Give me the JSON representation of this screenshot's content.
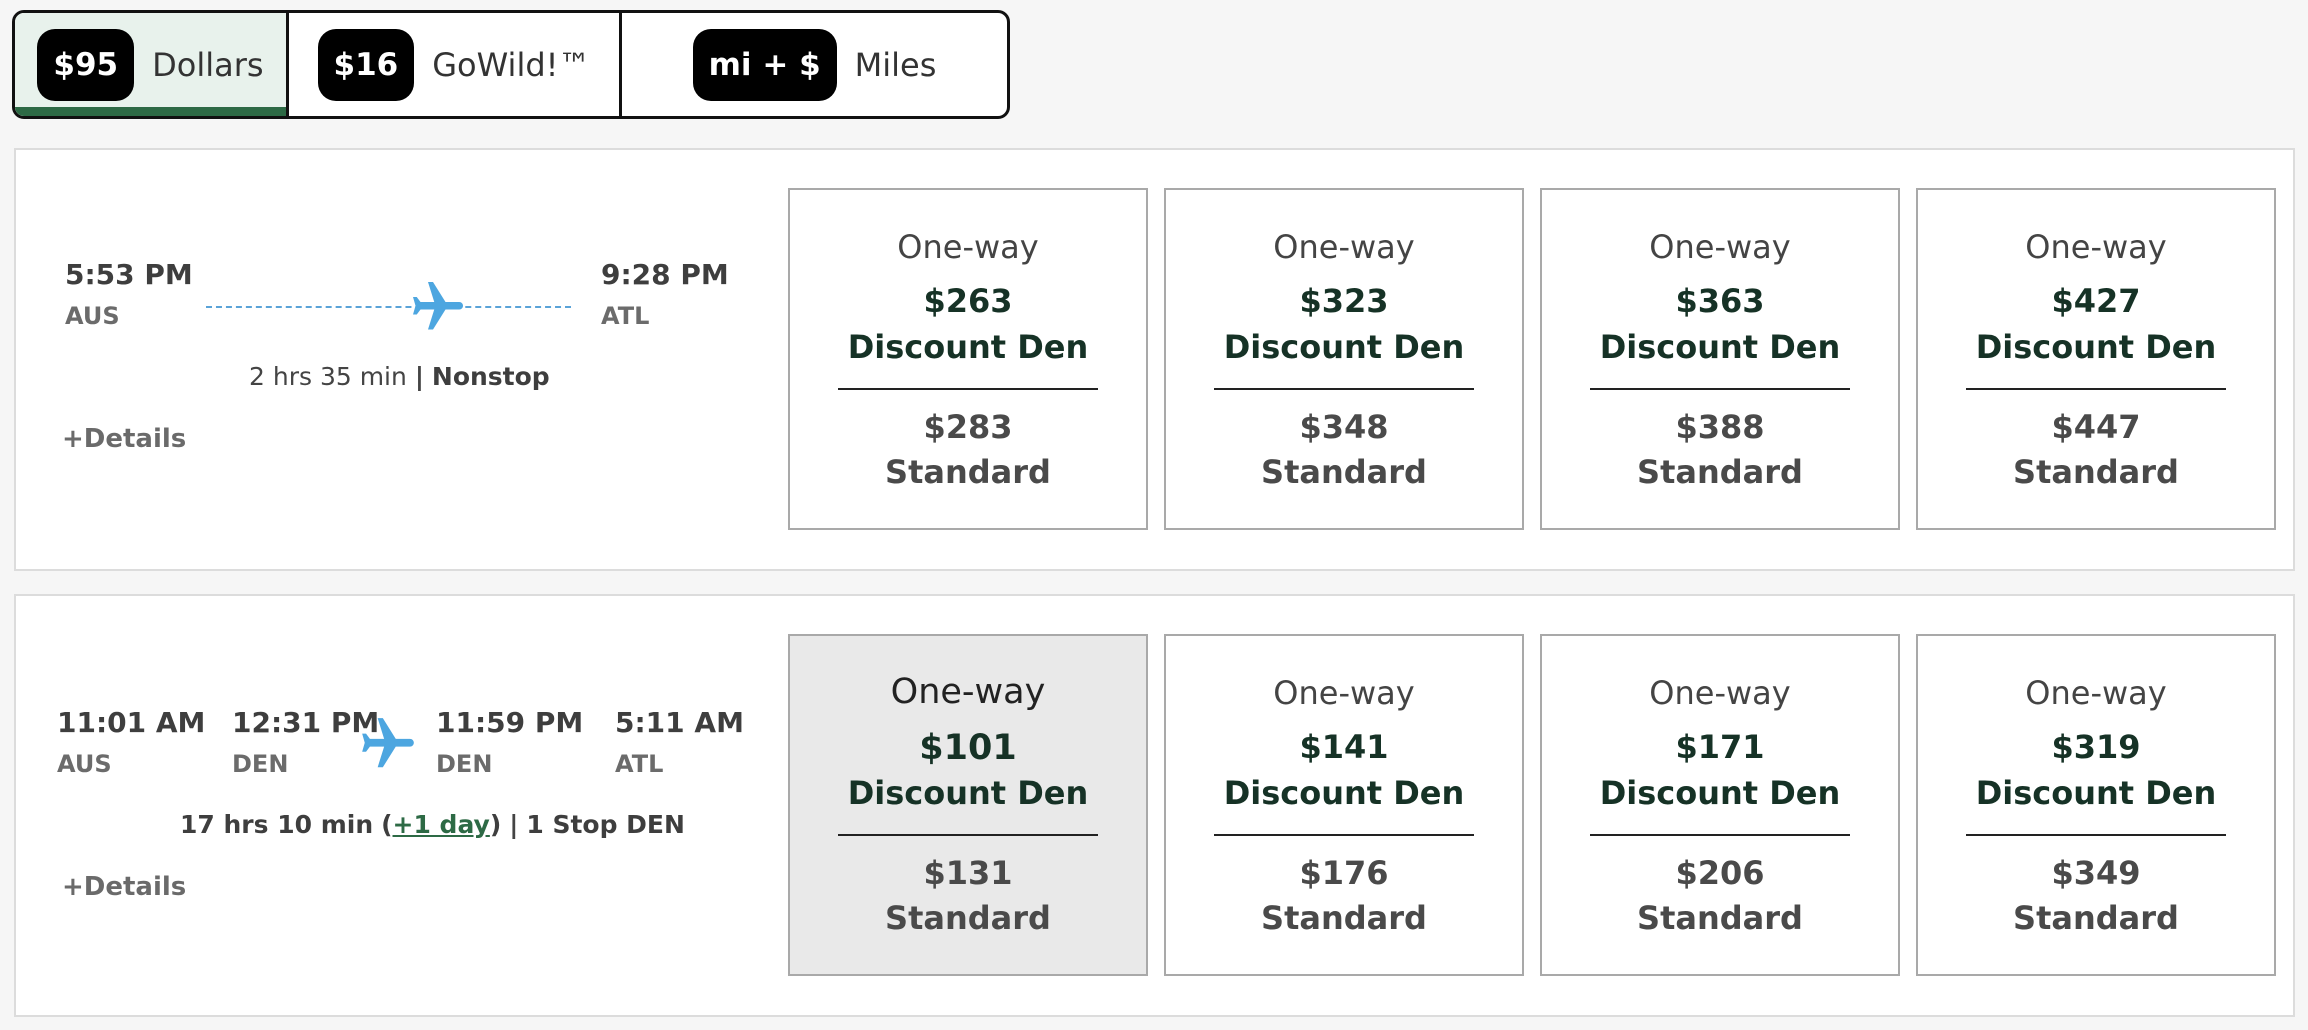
{
  "fare_tabs": [
    {
      "badge": "$95",
      "label": "Dollars",
      "selected": true
    },
    {
      "badge": "$16",
      "label": "GoWild!™",
      "selected": false
    },
    {
      "badge": "mi + $",
      "label": "Miles",
      "selected": false
    }
  ],
  "colors": {
    "accent_green": "#2d6a45",
    "fare_text": "#163226",
    "route_line": "#5aa3d8",
    "plane": "#4da6e0"
  },
  "flights": [
    {
      "depart_time": "5:53 PM",
      "depart_airport": "AUS",
      "arrive_time": "9:28 PM",
      "arrive_airport": "ATL",
      "duration": "2 hrs 35 min",
      "separator": "|",
      "stops": "Nonstop",
      "details_label": "+Details",
      "fares": [
        {
          "type": "One-way",
          "discount_price": "$263",
          "discount_label": "Discount Den",
          "standard_price": "$283",
          "standard_label": "Standard"
        },
        {
          "type": "One-way",
          "discount_price": "$323",
          "discount_label": "Discount Den",
          "standard_price": "$348",
          "standard_label": "Standard"
        },
        {
          "type": "One-way",
          "discount_price": "$363",
          "discount_label": "Discount Den",
          "standard_price": "$388",
          "standard_label": "Standard"
        },
        {
          "type": "One-way",
          "discount_price": "$427",
          "discount_label": "Discount Den",
          "standard_price": "$447",
          "standard_label": "Standard"
        }
      ]
    },
    {
      "depart_time": "11:01 AM",
      "depart_airport": "AUS",
      "connect_arrive_time": "12:31 PM",
      "connect_arrive_airport": "DEN",
      "connect_depart_time": "11:59 PM",
      "connect_depart_airport": "DEN",
      "arrive_time": "5:11 AM",
      "arrive_airport": "ATL",
      "duration": "17 hrs 10 min",
      "plus_day": "+1 day",
      "separator": "|",
      "stops": "1 Stop DEN",
      "details_label": "+Details",
      "fares": [
        {
          "type": "One-way",
          "discount_price": "$101",
          "discount_label": "Discount Den",
          "standard_price": "$131",
          "standard_label": "Standard",
          "selected": true
        },
        {
          "type": "One-way",
          "discount_price": "$141",
          "discount_label": "Discount Den",
          "standard_price": "$176",
          "standard_label": "Standard"
        },
        {
          "type": "One-way",
          "discount_price": "$171",
          "discount_label": "Discount Den",
          "standard_price": "$206",
          "standard_label": "Standard"
        },
        {
          "type": "One-way",
          "discount_price": "$319",
          "discount_label": "Discount Den",
          "standard_price": "$349",
          "standard_label": "Standard"
        }
      ]
    }
  ]
}
